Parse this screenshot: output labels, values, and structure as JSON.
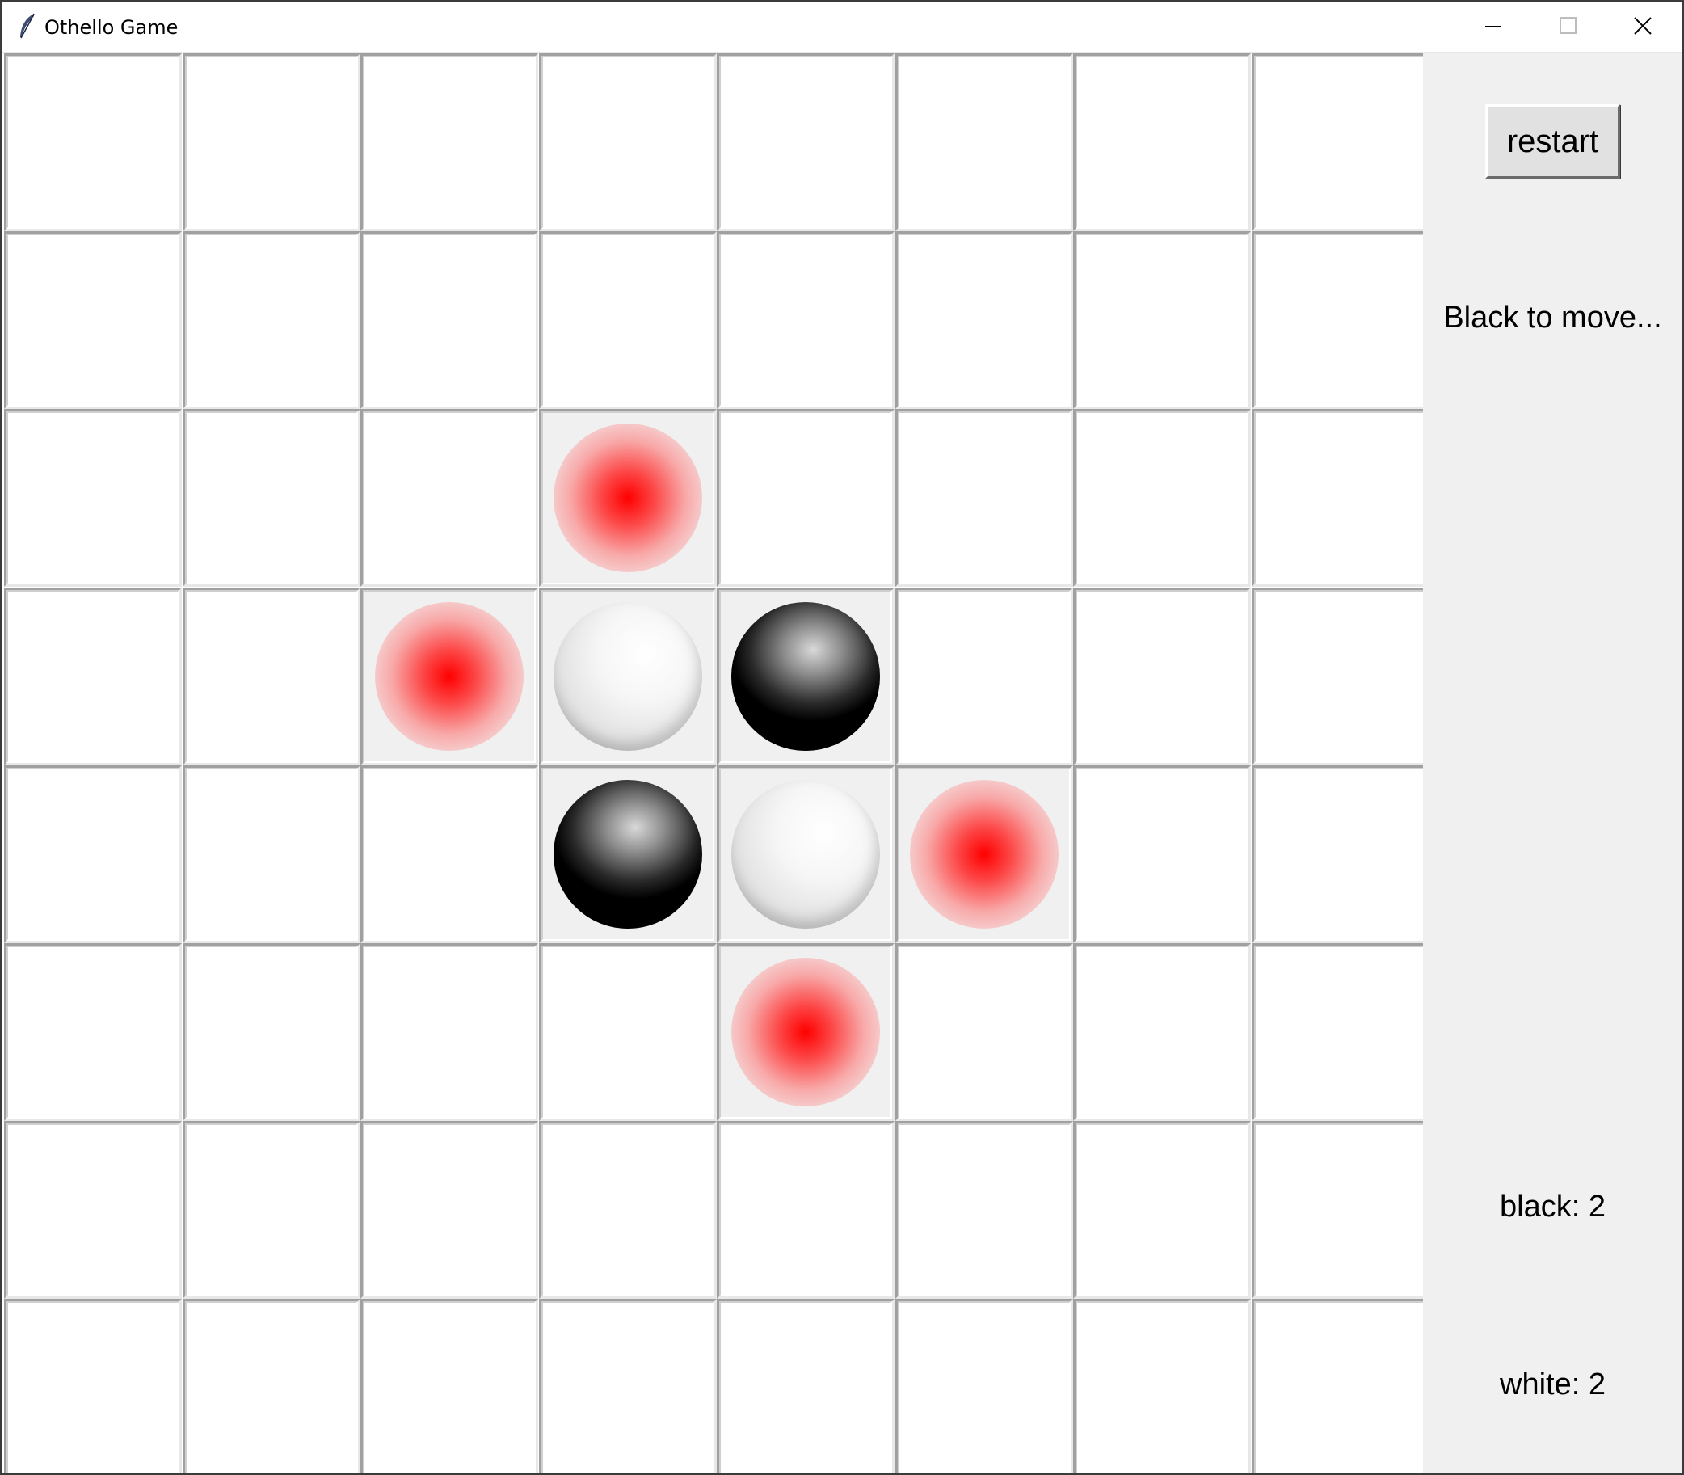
{
  "window": {
    "title": "Othello Game",
    "icon": "feather-icon",
    "controls": [
      "minimize-icon",
      "maximize-icon",
      "close-icon"
    ]
  },
  "board": {
    "size": 8,
    "rows": [
      [
        "",
        "",
        "",
        "",
        "",
        "",
        "",
        ""
      ],
      [
        "",
        "",
        "",
        "",
        "",
        "",
        "",
        ""
      ],
      [
        "",
        "",
        "",
        "hint",
        "",
        "",
        "",
        ""
      ],
      [
        "",
        "",
        "hint",
        "white",
        "black",
        "",
        "",
        ""
      ],
      [
        "",
        "",
        "",
        "black",
        "white",
        "hint",
        "",
        ""
      ],
      [
        "",
        "",
        "",
        "",
        "hint",
        "",
        "",
        ""
      ],
      [
        "",
        "",
        "",
        "",
        "",
        "",
        "",
        ""
      ],
      [
        "",
        "",
        "",
        "",
        "",
        "",
        "",
        ""
      ]
    ],
    "colors": {
      "hint": "#ff0000",
      "black": "#000000",
      "white": "#f2f2f2",
      "occupied_cell": "#f0f0f0",
      "empty_cell": "#ffffff"
    }
  },
  "sidebar": {
    "restart_label": "restart",
    "status": "Black to move...",
    "black_score": "black: 2",
    "white_score": "white: 2"
  }
}
